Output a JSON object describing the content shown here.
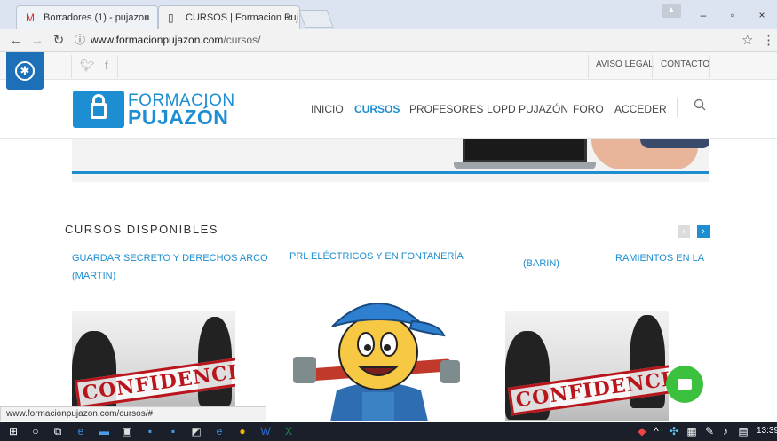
{
  "browser": {
    "tabs": [
      {
        "label": "Borradores (1) - pujazon",
        "icon": "gmail-icon"
      },
      {
        "label": "CURSOS | Formacion Puj",
        "icon": "page-icon"
      }
    ],
    "url_host": "www.formacionpujazon.com",
    "url_path": "/cursos/",
    "status_url": "www.formacionpujazon.com/cursos/#"
  },
  "topbar": {
    "links": [
      "AVISO LEGAL",
      "CONTACTO"
    ]
  },
  "logo": {
    "line1": "FORMACION",
    "line2": "PUJAZÓN"
  },
  "nav": {
    "items": [
      "INICIO",
      "CURSOS",
      "PROFESORES",
      "LOPD PUJAZÓN",
      "FORO",
      "ACCEDER"
    ],
    "active": "CURSOS"
  },
  "courses": {
    "title": "CURSOS DISPONIBLES",
    "cards": [
      {
        "title_line1": "GUARDAR SECRETO Y DERECHOS ARCO",
        "title_line2": "(MARTIN)",
        "stamp": "CONFIDENCIAL"
      },
      {
        "title_line1": "PRL ELÉCTRICOS Y EN FONTANERÍA"
      },
      {
        "title_overlay": "(BARIN)",
        "title_partial": "RAMIENTOS EN LA",
        "stamp": "CONFIDENCIAL"
      }
    ]
  },
  "taskbar": {
    "time": "13:39"
  },
  "colors": {
    "brand": "#1d8ed1",
    "chat": "#3cc13f",
    "stamp": "#b8161c"
  }
}
